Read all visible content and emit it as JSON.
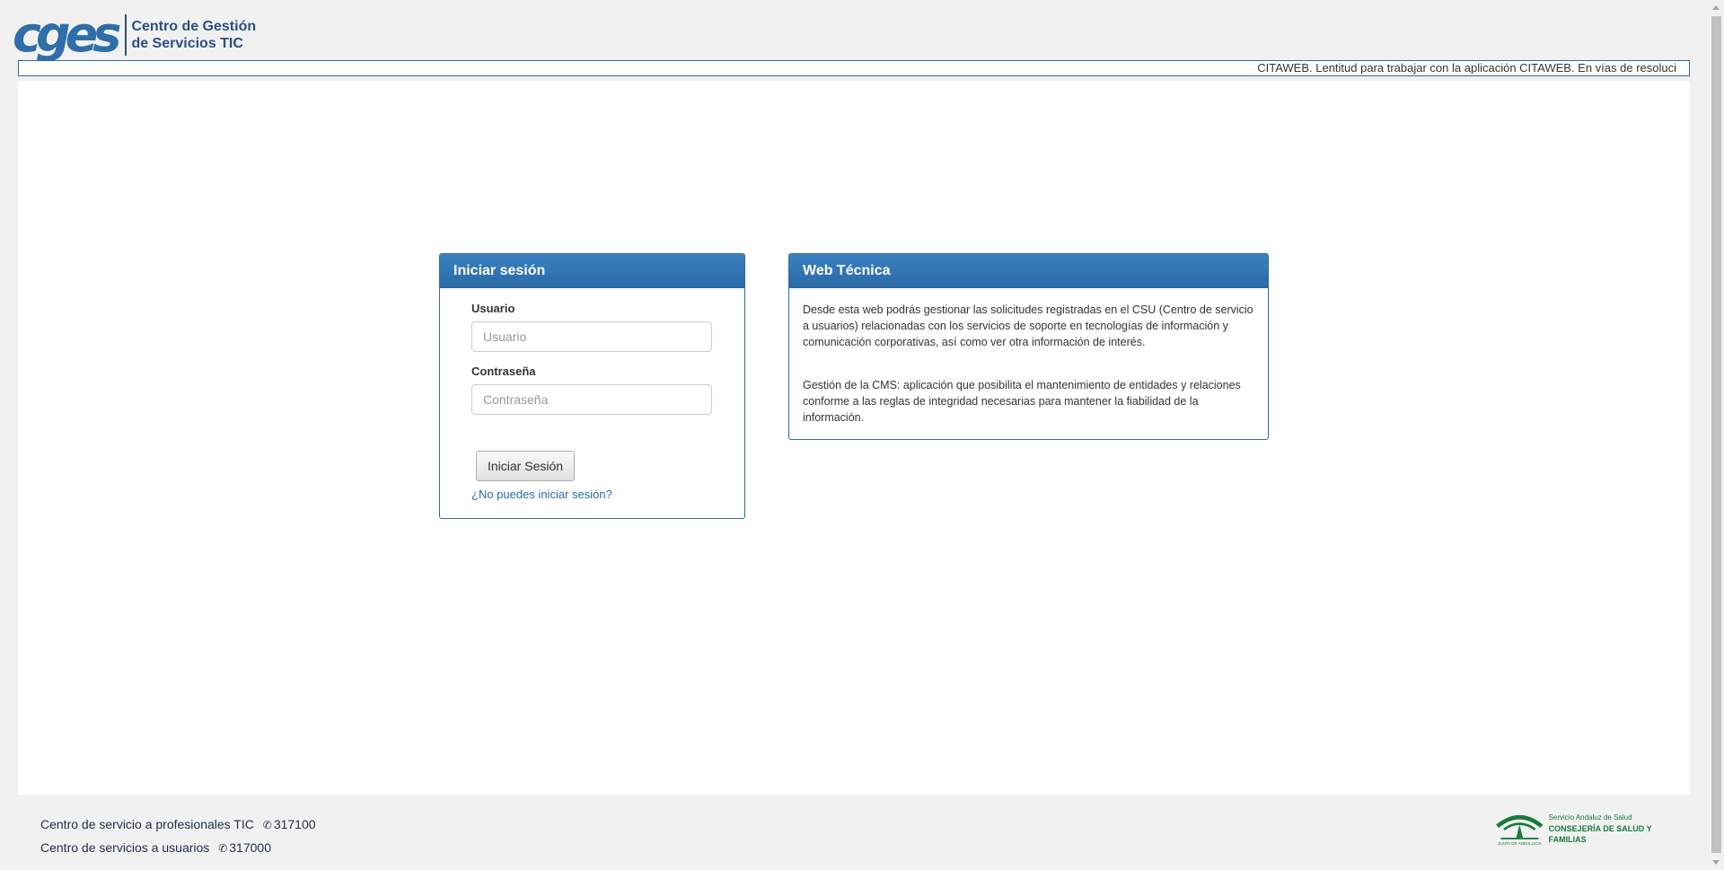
{
  "header": {
    "logo_mark": "cges",
    "logo_line1": "Centro de Gestión",
    "logo_line2": "de Servicios TIC"
  },
  "ticker": {
    "text": "CITAWEB. Lentitud para trabajar con la aplicación CITAWEB. En vías de resoluci"
  },
  "login": {
    "title": "Iniciar sesión",
    "user_label": "Usuario",
    "user_placeholder": "Usuario",
    "user_value": "",
    "pass_label": "Contraseña",
    "pass_placeholder": "Contraseña",
    "pass_value": "",
    "submit_label": "Iniciar Sesión",
    "forgot_label": "¿No puedes iniciar sesión?"
  },
  "info": {
    "title": "Web Técnica",
    "paragraph1": "Desde esta web podrás gestionar las solicitudes registradas en el CSU (Centro de servicio a usuarios) relacionadas con los servicios de soporte en tecnologías de información y comunicación corporativas, así como ver otra información de interés.",
    "paragraph2": "Gestión de la CMS: aplicación que posibilita el mantenimiento de entidades y relaciones conforme a las reglas de integridad necesarias para mantener la fiabilidad de la información."
  },
  "footer": {
    "line1_label": "Centro de servicio a profesionales TIC",
    "line1_phone": "317100",
    "line2_label": "Centro de servicios a usuarios",
    "line2_phone": "317000",
    "logo_junta": "JUNTA DE ANDALUCIA",
    "logo_sas": "Servicio Andaluz de Salud",
    "logo_consejeria": "CONSEJERÍA DE SALUD Y FAMILIAS"
  },
  "colors": {
    "accent": "#2d6a9f",
    "link": "#2a6aa6",
    "junta_green": "#1a7a3a"
  }
}
